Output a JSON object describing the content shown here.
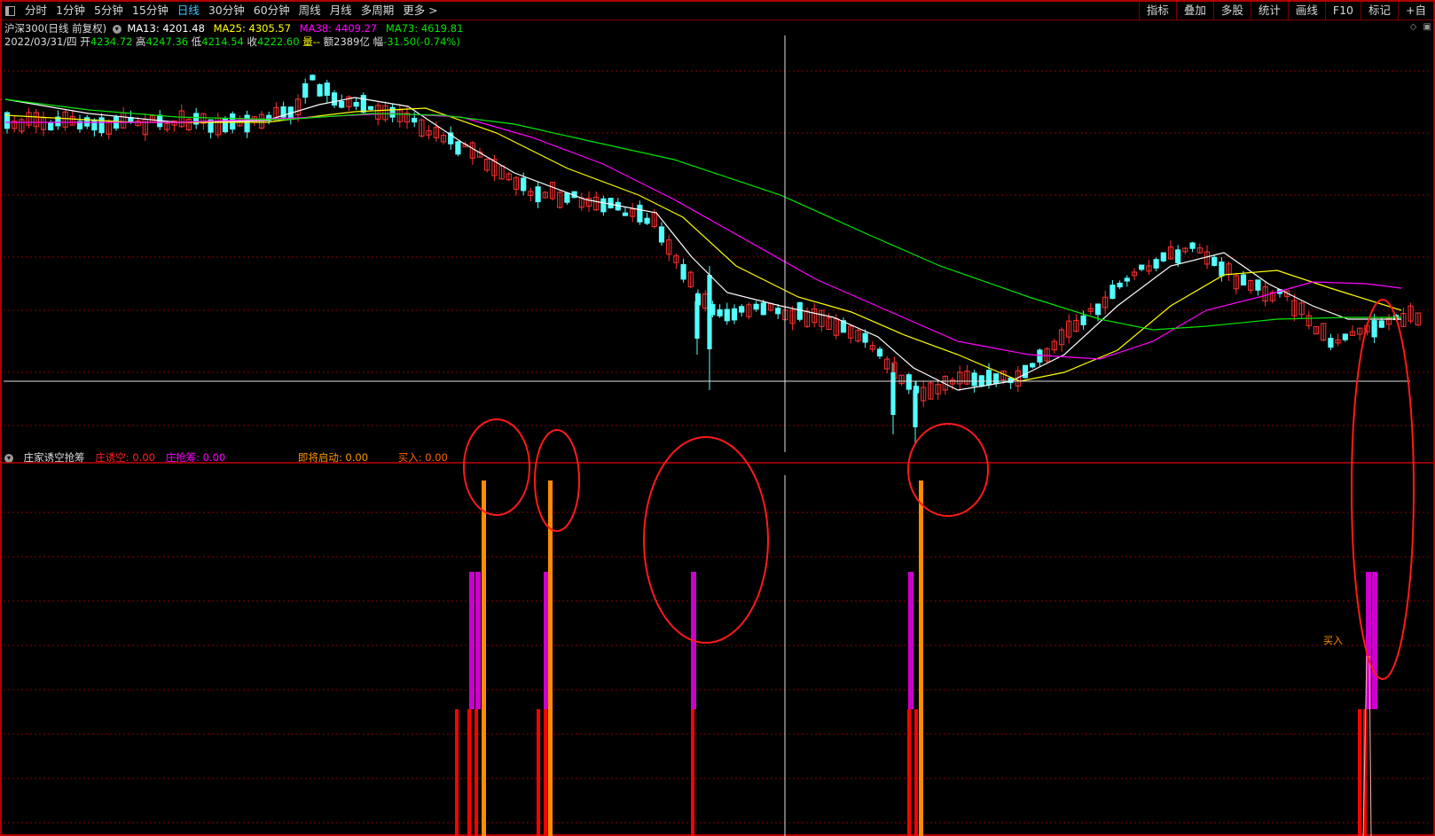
{
  "toolbar": {
    "periods": [
      "分时",
      "1分钟",
      "5分钟",
      "15分钟",
      "日线",
      "30分钟",
      "60分钟",
      "周线",
      "月线",
      "多周期",
      "更多 >"
    ],
    "active_period": "日线",
    "tools": [
      "指标",
      "叠加",
      "多股",
      "统计",
      "画线",
      "F10",
      "标记",
      "+自"
    ]
  },
  "header": {
    "title": "沪深300(日线 前复权)",
    "ma13_label": "MA13: 4201.48",
    "ma25_label": "MA25: 4305.57",
    "ma38_label": "MA38: 4409.27",
    "ma73_label": "MA73: 4619.81",
    "date": "2022/03/31/四",
    "open_label": "开",
    "open": "4234.72",
    "high_label": "高",
    "high": "4247.36",
    "low_label": "低",
    "low": "4214.54",
    "close_label": "收",
    "close": "4222.60",
    "volume_label": "量--",
    "amount_label": "额",
    "amount": "2389亿",
    "change_label": "幅",
    "change": "-31.50(-0.74%)"
  },
  "indicator": {
    "name": "庄家诱空抢筹",
    "s1": "庄诱空: 0.00",
    "s2": "庄抢筹: 0.00",
    "s3": "即将启动: 0.00",
    "s4": "买入: 0.00",
    "buy_marker": "买入"
  },
  "colors": {
    "up": "#ff3232",
    "down": "#54ffff",
    "ma13": "#ffffff",
    "ma25": "#ffff00",
    "ma38": "#ff00ff",
    "ma73": "#00e600",
    "grid": "#8a0000",
    "orange": "#ff8c00",
    "magenta": "#cc00cc",
    "red": "#ff0000"
  },
  "chart_data": {
    "type": "candlestick",
    "y_range_visible": "approx 3900 - 4600",
    "series": [
      {
        "name": "MA13",
        "last": 4201.48
      },
      {
        "name": "MA25",
        "last": 4305.57
      },
      {
        "name": "MA38",
        "last": 4409.27
      },
      {
        "name": "MA73",
        "last": 4619.81
      }
    ]
  }
}
